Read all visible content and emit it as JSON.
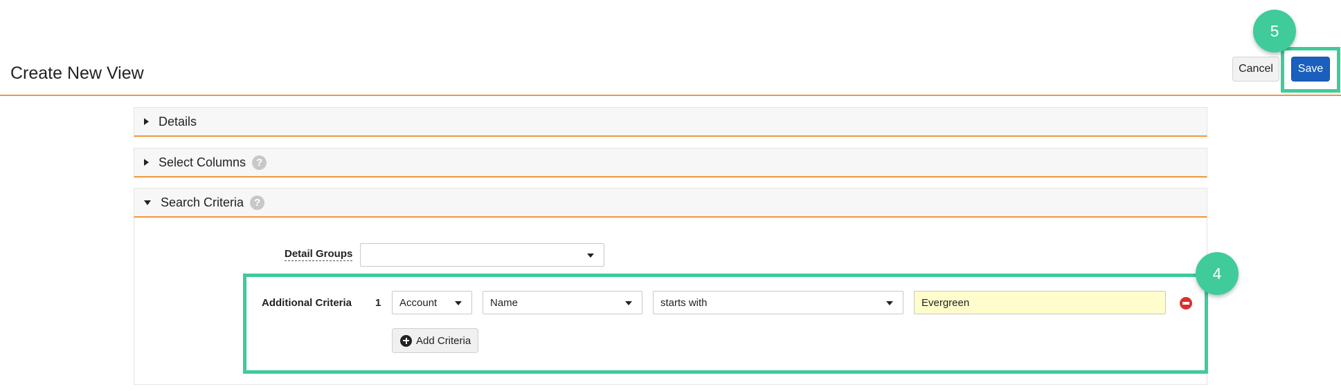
{
  "header": {
    "title": "Create New View",
    "cancel_label": "Cancel",
    "save_label": "Save"
  },
  "annotations": {
    "step_save": "5",
    "step_criteria": "4",
    "highlight_color": "#3fcb9a"
  },
  "sections": {
    "details": {
      "label": "Details",
      "expanded": false
    },
    "select_columns": {
      "label": "Select Columns",
      "expanded": false,
      "help_icon": "question-circle-icon"
    },
    "search_criteria": {
      "label": "Search Criteria",
      "expanded": true,
      "help_icon": "question-circle-icon"
    }
  },
  "search": {
    "detail_groups_label": "Detail Groups",
    "detail_groups_value": "",
    "additional_criteria_label": "Additional Criteria",
    "criteria": [
      {
        "number": "1",
        "object": "Account",
        "field": "Name",
        "operator": "starts with",
        "value": "Evergreen"
      }
    ],
    "add_criteria_label": "Add Criteria"
  },
  "colors": {
    "accent_rule": "#f0953b",
    "primary_button": "#1a5fbd",
    "input_highlight": "#fefdcb",
    "remove": "#d9312b"
  }
}
